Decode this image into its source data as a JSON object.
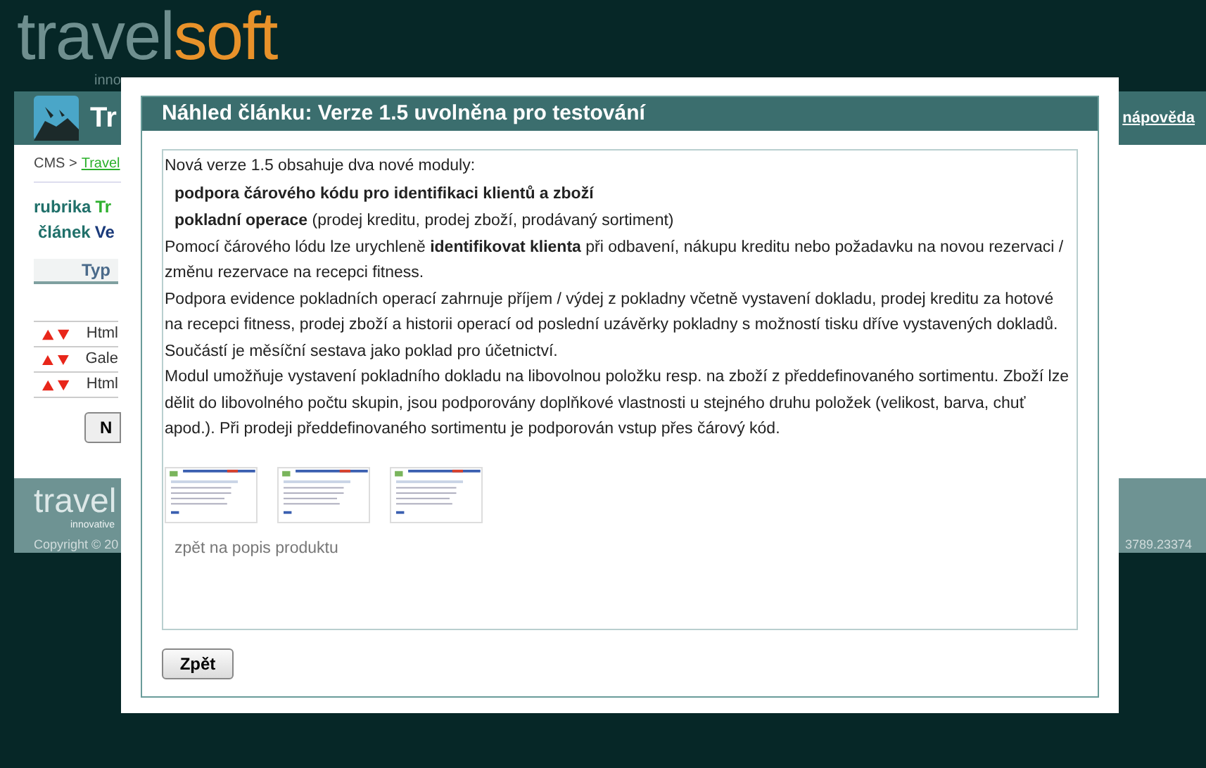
{
  "logo": {
    "part1": "travel",
    "part2": "soft",
    "tagline": "inno"
  },
  "header": {
    "title": "Tr",
    "help_link": "nápověda"
  },
  "breadcrumb": {
    "root": "CMS >",
    "link": "Travel"
  },
  "fields": [
    {
      "label": "rubrika",
      "value": "Tr",
      "kind": "green"
    },
    {
      "label": "článek",
      "value": "Ve",
      "kind": "blue"
    }
  ],
  "table": {
    "column": "Typ",
    "rows": [
      "Html",
      "Gale",
      "Html"
    ]
  },
  "page_button": "N",
  "footer": {
    "logo": "travel",
    "tagline": "innovative",
    "copyright": "Copyright © 20",
    "phone": "3789.23374"
  },
  "dialog": {
    "title": "Náhled článku: Verze 1.5 uvolněna pro testování",
    "intro": "Nová verze 1.5 obsahuje dva nové moduly:",
    "bullets": [
      "**podpora čárového kódu pro identifikaci klientů a zboží**",
      "**pokladní operace** (prodej kreditu, prodej zboží, prodávaný sortiment)"
    ],
    "paragraphs": [
      "Pomocí čárového lódu lze urychleně **identifikovat klienta** při odbavení, nákupu kreditu nebo požadavku na novou rezervaci / změnu rezervace na recepci fitness.",
      "Podpora evidence pokladních operací zahrnuje příjem / výdej z  pokladny včetně vystavení dokladu, prodej kreditu za hotové na recepci fitness, prodej zboží a historii operací od poslední uzávěrky pokladny s možností tisku dříve vystavených dokladů. Součástí je měsíční sestava jako poklad pro účetnictví.",
      "Modul umožňuje vystavení pokladního dokladu na libovolnou položku resp. na zboží z předdefinovaného sortimentu. Zboží lze dělit do libovolného počtu skupin, jsou podporovány doplňkové vlastnosti u  stejného druhu položek (velikost, barva, chuť apod.). Při prodeji předdefinovaného sortimentu je podporován vstup přes čárový kód."
    ],
    "thumbnails": [
      {
        "kind": "picture"
      },
      {
        "kind": "picture"
      },
      {
        "kind": "picture"
      }
    ],
    "back_link": "zpět na popis produktu",
    "button": "Zpět"
  }
}
